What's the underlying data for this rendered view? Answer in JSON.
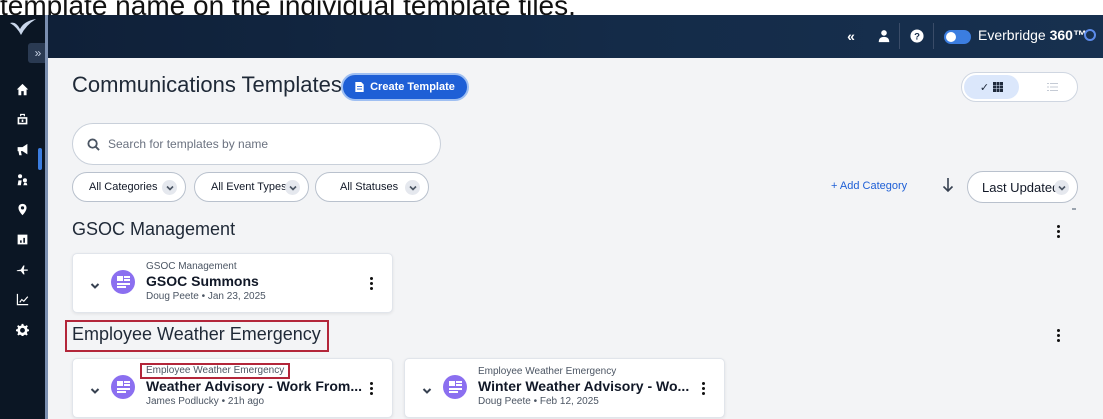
{
  "caption": "template name on the individual template tiles.",
  "topbar": {
    "collapse_label": "«",
    "brand_name": "Everbridge",
    "brand_product": "360™"
  },
  "sidebar": {
    "expand_label": "»",
    "items": [
      {
        "icon": "home-icon"
      },
      {
        "icon": "incidents-icon"
      },
      {
        "icon": "communications-icon",
        "active": true
      },
      {
        "icon": "people-icon"
      },
      {
        "icon": "map-pin-icon"
      },
      {
        "icon": "dashboard-icon"
      },
      {
        "icon": "travel-icon"
      },
      {
        "icon": "analytics-icon"
      },
      {
        "icon": "settings-icon"
      }
    ]
  },
  "header": {
    "title": "Communications Templates",
    "create_button": "Create Template",
    "view_grid_check": "✓"
  },
  "search": {
    "placeholder": "Search for templates by name",
    "value": ""
  },
  "filters": {
    "categories": "All Categories",
    "event_types": "All Event Types",
    "statuses": "All Statuses",
    "add_category": "+ Add Category",
    "sort": "Last Updated"
  },
  "sections": [
    {
      "title": "GSOC Management",
      "cards": [
        {
          "category": "GSOC Management",
          "name": "GSOC Summons",
          "meta": "Doug Peete • Jan 23, 2025"
        }
      ]
    },
    {
      "title": "Employee Weather Emergency",
      "cards": [
        {
          "category": "Employee Weather Emergency",
          "name": "Weather Advisory - Work From...",
          "meta": "James Podlucky • 21h ago"
        },
        {
          "category": "Employee Weather Emergency",
          "name": "Winter Weather Advisory - Wo...",
          "meta": "Doug Peete • Feb 12, 2025"
        }
      ]
    }
  ],
  "colors": {
    "accent": "#1e5fd6",
    "highlight": "#b3263a",
    "avatar": "#8b6ff0",
    "nav_bg": "#0b1624"
  }
}
